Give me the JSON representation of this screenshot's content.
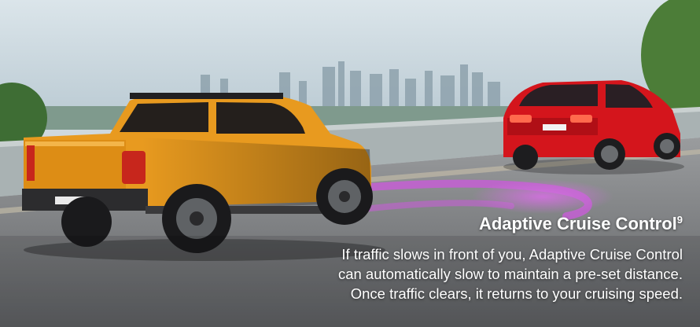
{
  "caption": {
    "title": "Adaptive Cruise Control",
    "title_superscript": "9",
    "body_lines": [
      "If traffic slows in front of you, Adaptive Cruise Control",
      "can automatically slow to maintain a pre-set distance.",
      "Once traffic clears, it returns to your cruising speed."
    ]
  },
  "scene": {
    "pickup_truck_color": "#e89a1f",
    "suv_color": "#d4151c",
    "radar_trail_color": "#c45fd3",
    "sky_color": "#c9d7df",
    "road_color": "#7d7f82"
  }
}
